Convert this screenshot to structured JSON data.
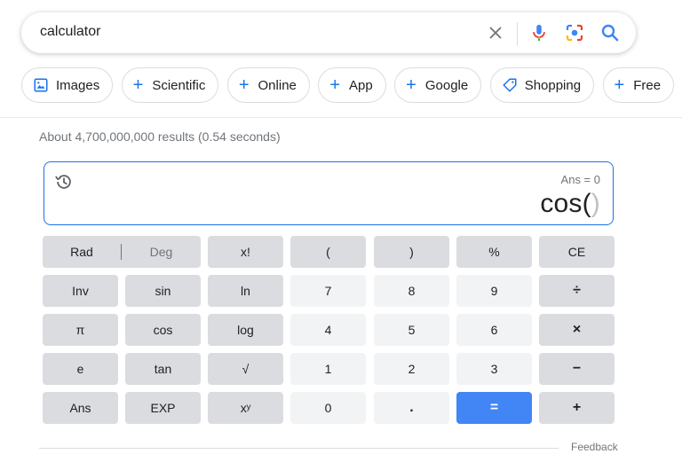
{
  "search": {
    "query": "calculator"
  },
  "chips": [
    {
      "label": "Images",
      "icon": "image-icon"
    },
    {
      "label": "Scientific",
      "icon": "plus-icon"
    },
    {
      "label": "Online",
      "icon": "plus-icon"
    },
    {
      "label": "App",
      "icon": "plus-icon"
    },
    {
      "label": "Google",
      "icon": "plus-icon"
    },
    {
      "label": "Shopping",
      "icon": "tag-icon"
    },
    {
      "label": "Free",
      "icon": "plus-icon"
    }
  ],
  "results": {
    "stats": "About 4,700,000,000 results (0.54 seconds)"
  },
  "calculator": {
    "ans": "Ans = 0",
    "expression": "cos(",
    "expression_ghost": ")",
    "mode": {
      "rad": "Rad",
      "deg": "Deg",
      "active": "Rad"
    },
    "keys": {
      "fact": "x!",
      "lparen": "(",
      "rparen": ")",
      "percent": "%",
      "ce": "CE",
      "inv": "Inv",
      "sin": "sin",
      "ln": "ln",
      "k7": "7",
      "k8": "8",
      "k9": "9",
      "divide": "÷",
      "pi": "π",
      "cos": "cos",
      "log": "log",
      "k4": "4",
      "k5": "5",
      "k6": "6",
      "multiply": "×",
      "e": "e",
      "tan": "tan",
      "sqrt": "√",
      "k1": "1",
      "k2": "2",
      "k3": "3",
      "minus": "−",
      "ans": "Ans",
      "exp": "EXP",
      "pow": "xʸ",
      "k0": "0",
      "dot": ".",
      "equals": "=",
      "plus": "+"
    }
  },
  "footer": {
    "feedback": "Feedback"
  },
  "colors": {
    "accent": "#1a73e8",
    "equals_key": "#4285f4",
    "fn_key": "#dadce0",
    "num_key": "#f1f3f4"
  }
}
